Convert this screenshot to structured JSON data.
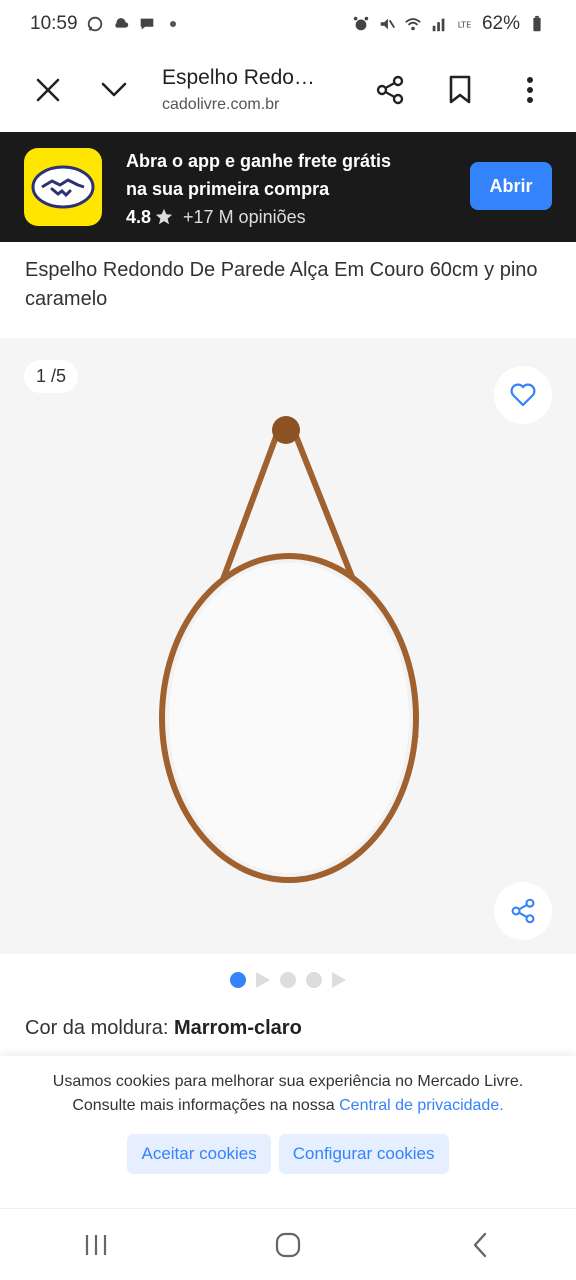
{
  "status": {
    "time": "10:59",
    "battery": "62%",
    "icons": [
      "whatsapp-icon",
      "cloud-icon",
      "chat-icon",
      "alarm-icon",
      "mute-icon",
      "wifi-icon",
      "signal-icon",
      "volte-icon",
      "battery-icon"
    ]
  },
  "browser": {
    "title": "Espelho Redo…",
    "url": "cadolivre.com.br",
    "icons": [
      "close-icon",
      "chevron-down-icon",
      "share-icon",
      "bookmark-icon",
      "more-icon"
    ]
  },
  "app_banner": {
    "line1": "Abra o app e ganhe frete grátis",
    "line2": "na sua primeira compra",
    "rating": "4.8",
    "reviews": "+17 M opiniões",
    "open_label": "Abrir"
  },
  "product": {
    "title": "Espelho Redondo De Parede Alça Em Couro 60cm y pino caramelo"
  },
  "gallery": {
    "counter": "1 /5"
  },
  "color": {
    "label": "Cor da moldura: ",
    "value": "Marrom-claro"
  },
  "cookie": {
    "text": "Usamos cookies para melhorar sua experiência no Mercado Livre. Consulte mais informações na nossa ",
    "link": "Central de privacidade.",
    "accept": "Aceitar cookies",
    "configure": "Configurar cookies"
  },
  "colors": {
    "accent": "#3483fa",
    "banner_bg": "#1a1a1a",
    "logo_yellow": "#ffe600",
    "leather": "#a0612e"
  }
}
